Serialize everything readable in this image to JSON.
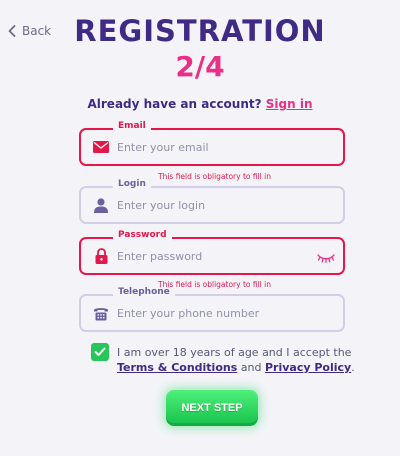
{
  "header": {
    "back_label": "Back",
    "title": "REGISTRATION",
    "step": "2/4"
  },
  "account": {
    "prompt": "Already have an account?",
    "signin_label": "Sign in"
  },
  "fields": [
    {
      "label": "Email",
      "placeholder": "Enter your email",
      "icon": "envelope-icon",
      "error": "This field is obligatory to fill in"
    },
    {
      "label": "Login",
      "placeholder": "Enter your login",
      "icon": "user-icon"
    },
    {
      "label": "Password",
      "placeholder": "Enter password",
      "icon": "lock-icon",
      "error": "This field is obligatory to fill in",
      "toggle_icon": "eye-closed-icon"
    },
    {
      "label": "Telephone",
      "placeholder": "Enter your phone number",
      "icon": "phone-icon"
    }
  ],
  "agreement": {
    "checked": true,
    "text_before": "I am over 18 years of age and I accept the",
    "terms_link": "Terms & Conditions",
    "and": "and",
    "privacy_link": "Privacy Policy",
    "end": "."
  },
  "next_button": "NEXT STEP",
  "colors": {
    "title": "#3f2a86",
    "step": "#ec2f86",
    "error": "#e5174a",
    "button": "#1fd257"
  }
}
